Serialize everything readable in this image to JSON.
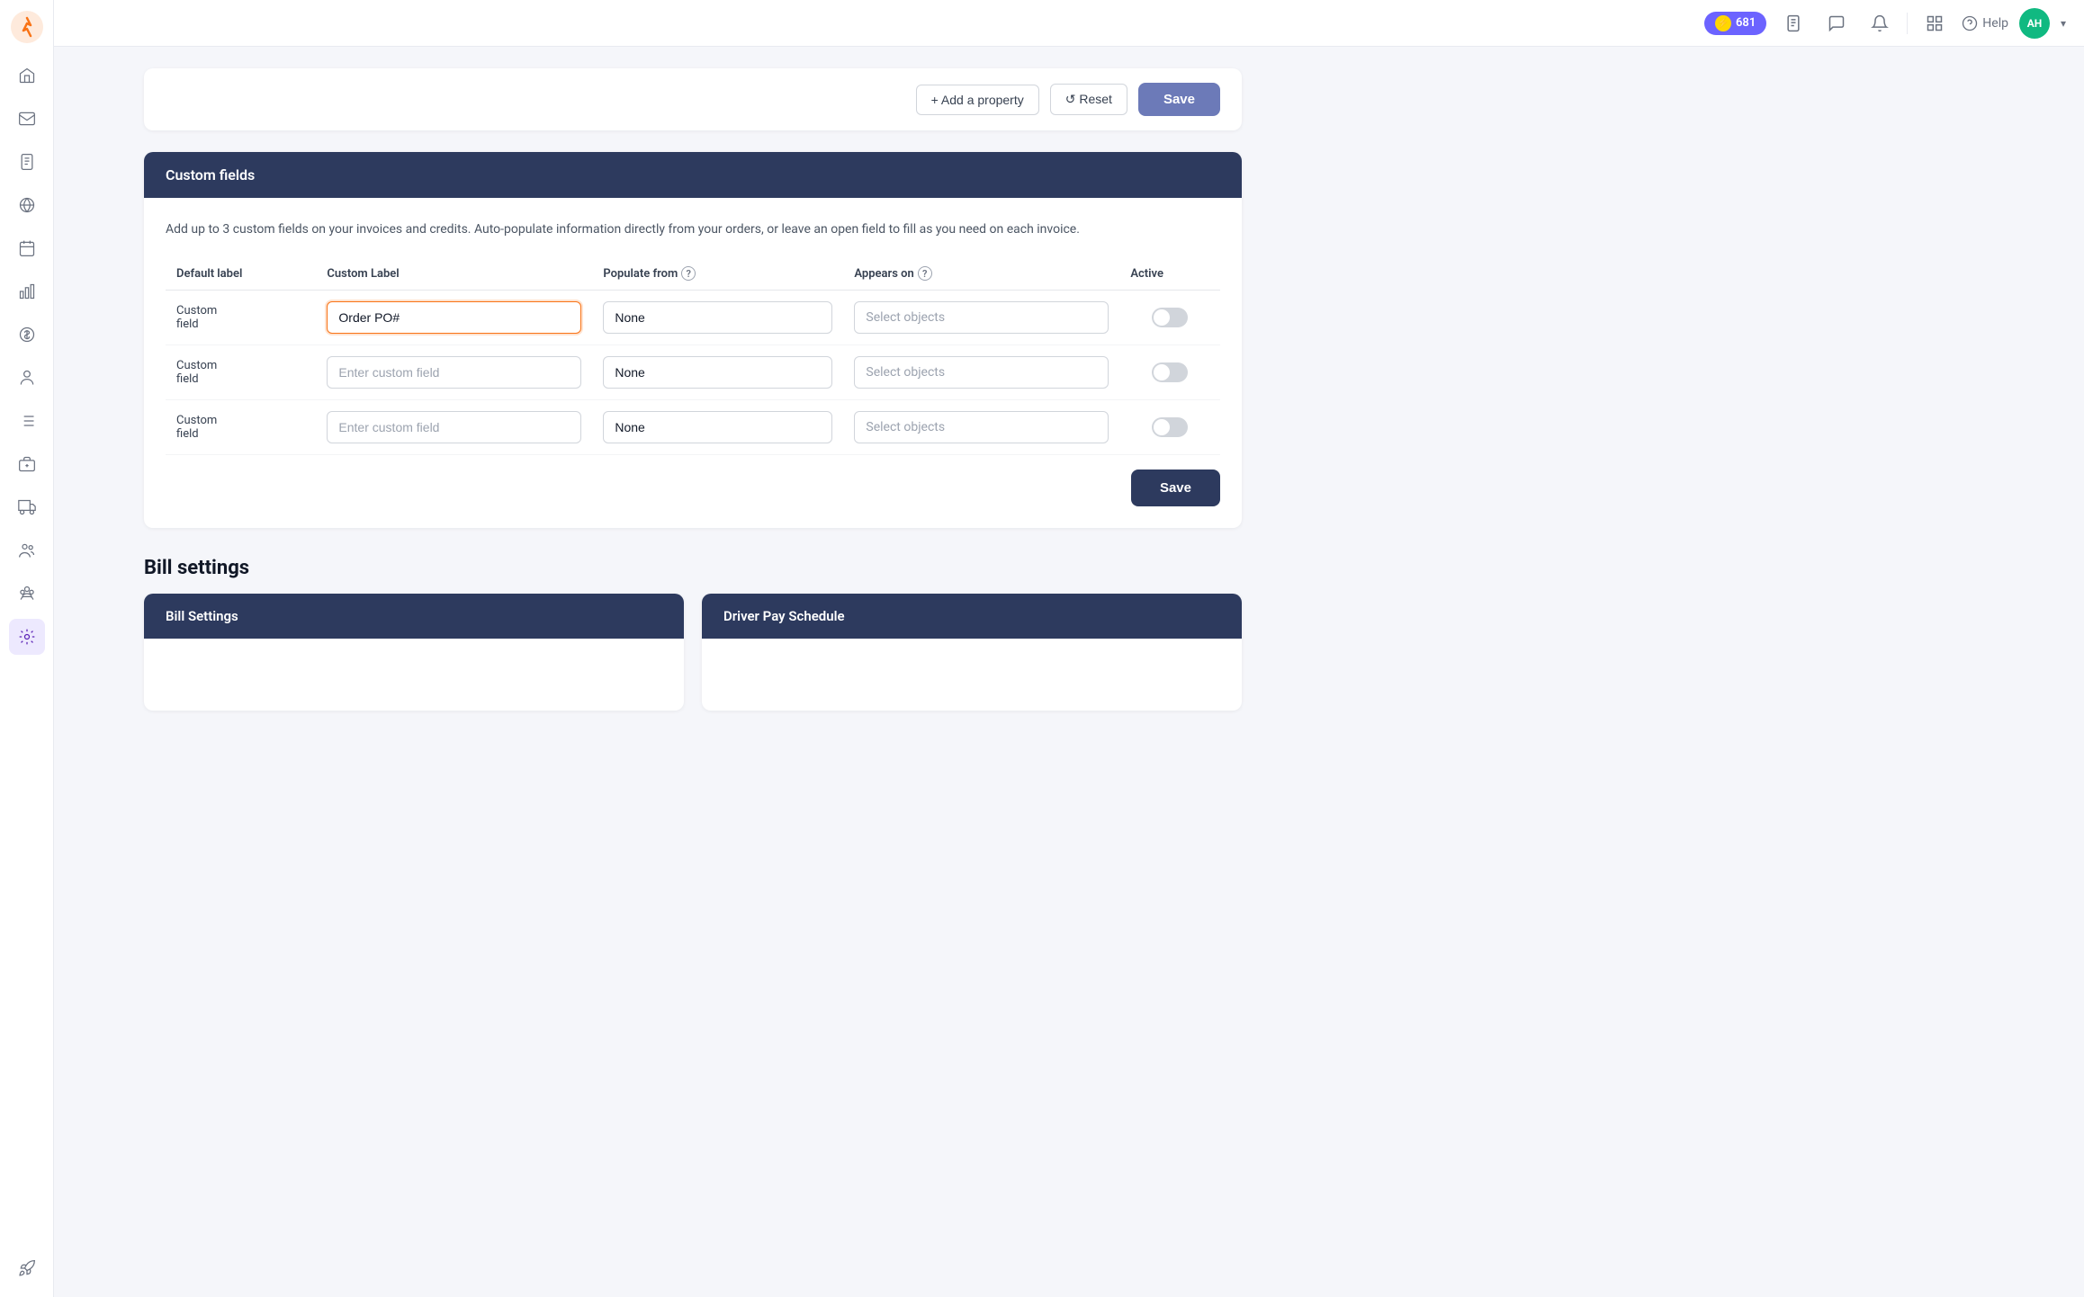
{
  "topbar": {
    "badge_count": "681",
    "help_label": "Help",
    "avatar_initials": "AH"
  },
  "sidebar": {
    "items": [
      {
        "name": "home",
        "icon": "home"
      },
      {
        "name": "mail",
        "icon": "mail"
      },
      {
        "name": "document",
        "icon": "document"
      },
      {
        "name": "globe",
        "icon": "globe"
      },
      {
        "name": "calendar",
        "icon": "calendar"
      },
      {
        "name": "chart",
        "icon": "chart"
      },
      {
        "name": "dollar",
        "icon": "dollar"
      },
      {
        "name": "person",
        "icon": "person"
      },
      {
        "name": "list",
        "icon": "list"
      },
      {
        "name": "briefcase",
        "icon": "briefcase"
      },
      {
        "name": "truck",
        "icon": "truck"
      },
      {
        "name": "people-group",
        "icon": "people-group"
      },
      {
        "name": "team",
        "icon": "team"
      },
      {
        "name": "settings",
        "icon": "settings",
        "active": true
      }
    ]
  },
  "property_actions": {
    "add_label": "+ Add a property",
    "reset_label": "↺ Reset",
    "save_top_label": "Save"
  },
  "custom_fields": {
    "section_title": "Custom fields",
    "description": "Add up to 3 custom fields on your invoices and credits. Auto-populate information directly from your orders, or leave an open field to fill as you need on each invoice.",
    "columns": {
      "default_label": "Default label",
      "custom_label": "Custom Label",
      "populate_from": "Populate from",
      "appears_on": "Appears on",
      "active": "Active"
    },
    "rows": [
      {
        "default": "Custom\nfield",
        "custom_value": "Order PO#",
        "custom_placeholder": "Enter custom field",
        "populate_value": "None",
        "appears_placeholder": "Select objects",
        "is_active": false,
        "has_focus": true
      },
      {
        "default": "Custom\nfield",
        "custom_value": "",
        "custom_placeholder": "Enter custom field",
        "populate_value": "None",
        "appears_placeholder": "Select objects",
        "is_active": false,
        "has_focus": false
      },
      {
        "default": "Custom\nfield",
        "custom_value": "",
        "custom_placeholder": "Enter custom field",
        "populate_value": "None",
        "appears_placeholder": "Select objects",
        "is_active": false,
        "has_focus": false
      }
    ],
    "save_label": "Save"
  },
  "bill_settings": {
    "title": "Bill settings",
    "cards": [
      {
        "header": "Bill Settings"
      },
      {
        "header": "Driver Pay Schedule"
      }
    ]
  }
}
